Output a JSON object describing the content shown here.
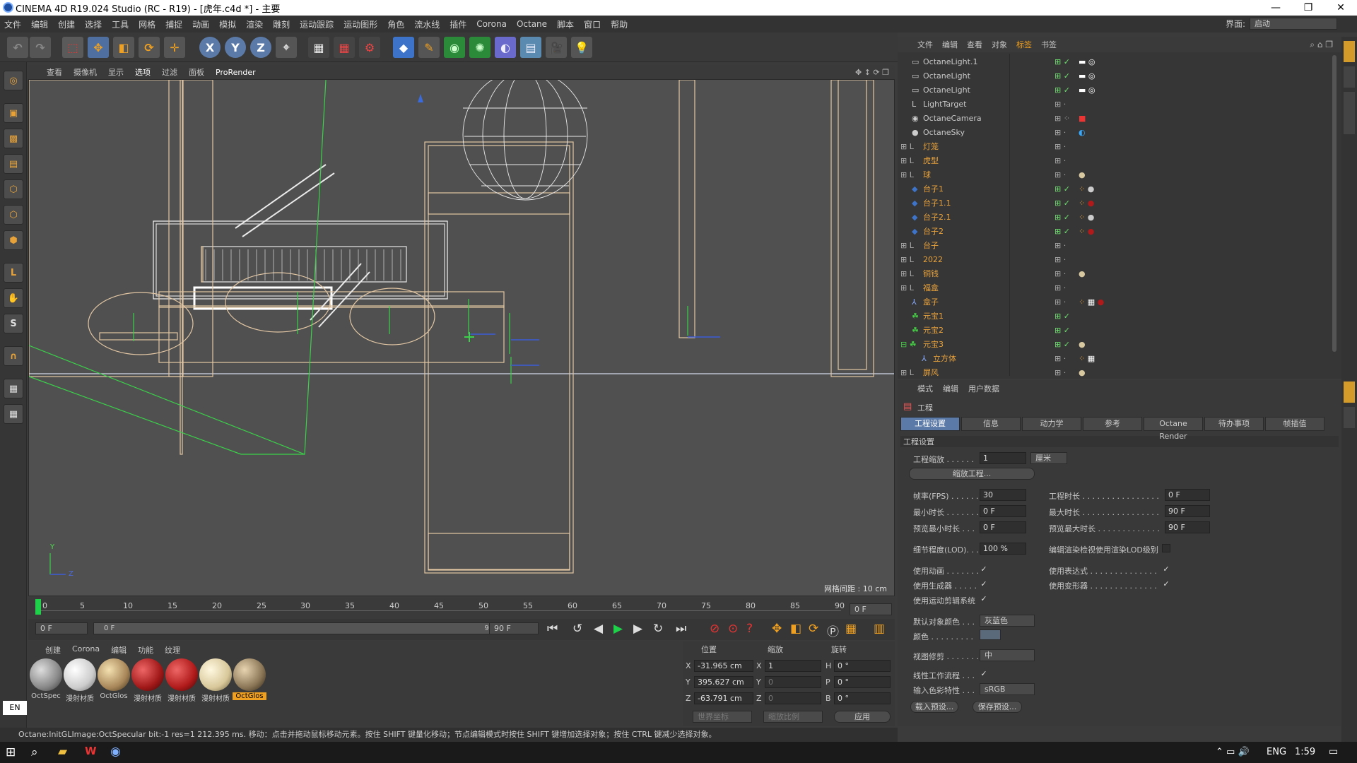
{
  "window": {
    "title": "CINEMA 4D R19.024 Studio (RC - R19) - [虎年.c4d *] - 主要"
  },
  "menubar": {
    "items": [
      "文件",
      "编辑",
      "创建",
      "选择",
      "工具",
      "网格",
      "捕捉",
      "动画",
      "模拟",
      "渲染",
      "雕刻",
      "运动跟踪",
      "运动图形",
      "角色",
      "流水线",
      "插件",
      "Corona",
      "Octane",
      "脚本",
      "窗口",
      "帮助"
    ],
    "layout_label": "界面:",
    "layout_value": "启动"
  },
  "viewport": {
    "menu": [
      "查看",
      "摄像机",
      "显示",
      "选项",
      "过滤",
      "面板"
    ],
    "prorender": "ProRender",
    "grid_spacing": "网格间距 : 10 cm",
    "axis_y": "Y",
    "axis_z": "Z"
  },
  "timeline": {
    "ticks": [
      "0",
      "5",
      "10",
      "15",
      "20",
      "25",
      "30",
      "35",
      "40",
      "45",
      "50",
      "55",
      "60",
      "65",
      "70",
      "75",
      "80",
      "85",
      "90"
    ],
    "current_frame": "0 F",
    "start_frame": "0 F",
    "range_start": "0 F",
    "range_end": "90 F",
    "end_frame": "90 F"
  },
  "materials": {
    "menu": [
      "创建",
      "Corona",
      "编辑",
      "功能",
      "纹理"
    ],
    "items": [
      {
        "name": "OctSpec",
        "color": "#9a9a9a"
      },
      {
        "name": "漫射材质",
        "color": "#e6e6e6"
      },
      {
        "name": "OctGlos",
        "color": "#a8875a"
      },
      {
        "name": "漫射材质",
        "color": "#a01818"
      },
      {
        "name": "漫射材质",
        "color": "#b01a1a"
      },
      {
        "name": "漫射材质",
        "color": "#d8c89a"
      },
      {
        "name": "OctGlos",
        "color": "#8a7556"
      }
    ],
    "lang": "EN"
  },
  "coords": {
    "headers": [
      "位置",
      "缩放",
      "旋转"
    ],
    "x_label": "X",
    "y_label": "Y",
    "z_label": "Z",
    "h_label": "H",
    "p_label": "P",
    "b_label": "B",
    "pos_x": "-31.965 cm",
    "pos_y": "395.627 cm",
    "pos_z": "-63.791 cm",
    "scale_x": "1",
    "scale_y": "0",
    "scale_z": "0",
    "rot_h": "0 °",
    "rot_p": "0 °",
    "rot_b": "0 °",
    "world": "世界坐标",
    "scale_mode": "缩放比例",
    "apply": "应用"
  },
  "status": {
    "text": "Octane:InitGLImage:OctSpecular  bit:-1 res=1  212.395 ms.     移动：点击并拖动鼠标移动元素。按住 SHIFT 键量化移动；节点编辑模式时按住 SHIFT 键增加选择对象；按住 CTRL 键减少选择对象。"
  },
  "object_manager": {
    "menu": [
      "文件",
      "编辑",
      "查看",
      "对象",
      "标签",
      "书签"
    ],
    "objects": [
      {
        "name": "OctaneLight.1",
        "color": "#c8c8c8"
      },
      {
        "name": "OctaneLight",
        "color": "#c8c8c8"
      },
      {
        "name": "OctaneLight",
        "color": "#c8c8c8"
      },
      {
        "name": "LightTarget",
        "color": "#c8c8c8"
      },
      {
        "name": "OctaneCamera",
        "color": "#c8c8c8"
      },
      {
        "name": "OctaneSky",
        "color": "#c8c8c8"
      },
      {
        "name": "灯笼",
        "color": "#e8a23c"
      },
      {
        "name": "虎型",
        "color": "#e8a23c"
      },
      {
        "name": "球",
        "color": "#e8a23c"
      },
      {
        "name": "台子1",
        "color": "#e8a23c"
      },
      {
        "name": "台子1.1",
        "color": "#e8a23c"
      },
      {
        "name": "台子2.1",
        "color": "#e8a23c"
      },
      {
        "name": "台子2",
        "color": "#e8a23c"
      },
      {
        "name": "台子",
        "color": "#e8a23c"
      },
      {
        "name": "2022",
        "color": "#e8a23c"
      },
      {
        "name": "铜钱",
        "color": "#e8a23c"
      },
      {
        "name": "福盒",
        "color": "#e8a23c"
      },
      {
        "name": "盒子",
        "color": "#e8a23c"
      },
      {
        "name": "元宝1",
        "color": "#e8a23c"
      },
      {
        "name": "元宝2",
        "color": "#e8a23c"
      },
      {
        "name": "元宝3",
        "color": "#e8a23c"
      },
      {
        "name": "立方体",
        "color": "#e8a23c"
      },
      {
        "name": "屏风",
        "color": "#e8a23c"
      }
    ]
  },
  "attributes": {
    "menu": [
      "模式",
      "编辑",
      "用户数据"
    ],
    "header": "工程",
    "tabs": [
      "工程设置",
      "信息",
      "动力学",
      "参考",
      "Octane Render",
      "待办事项",
      "帧插值"
    ],
    "section": "工程设置",
    "project_scale_label": "工程缩放 . . . . . .",
    "project_scale_value": "1",
    "project_scale_unit": "厘米",
    "scale_project_btn": "缩放工程...",
    "fps_label": "帧率(FPS) . . . . . .",
    "fps_value": "30",
    "project_time_label": "工程时长 . . . . . . . . . . . . . . . .",
    "project_time_value": "0 F",
    "min_time_label": "最小时长 . . . . . . .",
    "min_time_value": "0 F",
    "max_time_label": "最大时长 . . . . . . . . . . . . . . . .",
    "max_time_value": "90 F",
    "prev_min_label": "预览最小时长 . . .",
    "prev_min_value": "0 F",
    "prev_max_label": "预览最大时长 . . . . . . . . . . . . .",
    "prev_max_value": "90 F",
    "lod_label": "细节程度(LOD). . .",
    "lod_value": "100 %",
    "render_lod_label": "编辑渲染检视使用渲染LOD级别",
    "use_anim": "使用动画 . . . . . . .",
    "use_expr": "使用表达式 . . . . . . . . . . . . . .",
    "use_gen": "使用生成器 . . . . .",
    "use_deform": "使用变形器 . . . . . . . . . . . . . .",
    "use_motion": "使用运动剪辑系统",
    "default_color_label": "默认对象颜色 . . .",
    "default_color_value": "灰蓝色",
    "color_label": "颜色 . . . . . . . . .",
    "view_clip_label": "视图修剪 . . . . . . .",
    "view_clip_value": "中",
    "linear_label": "线性工作流程 . . .",
    "input_color_label": "输入色彩特性 . . .",
    "input_color_value": "sRGB",
    "load_preset": "载入预设...",
    "save_preset": "保存预设..."
  },
  "taskbar": {
    "lang": "ENG",
    "time": "1:59"
  }
}
